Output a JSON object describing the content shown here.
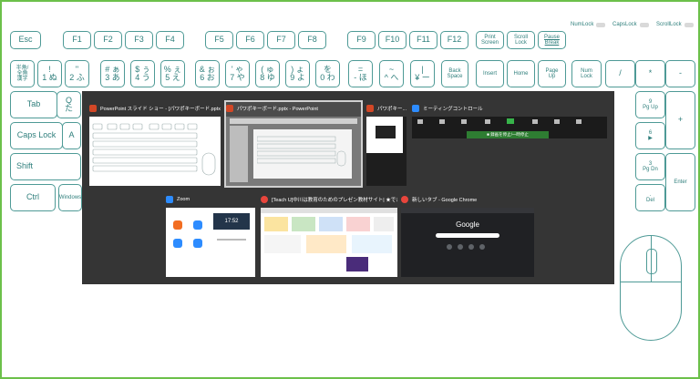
{
  "locks": [
    {
      "label": "NumLock"
    },
    {
      "label": "CapsLock"
    },
    {
      "label": "ScrollLock"
    }
  ],
  "keys": {
    "esc": "Esc",
    "f1": "F1",
    "f2": "F2",
    "f3": "F3",
    "f4": "F4",
    "f5": "F5",
    "f6": "F6",
    "f7": "F7",
    "f8": "F8",
    "f9": "F9",
    "f10": "F10",
    "f11": "F11",
    "f12": "F12",
    "print_screen": "Print\nScreen",
    "scroll_lock": "Scroll\nLock",
    "pause_break": "Pause\nBreak",
    "hankaku": "半角/\n全角\n漢字",
    "k1": "!\n1 ぬ",
    "k2": "\"\n2 ふ",
    "k3": "# ぁ\n3 あ",
    "k4": "$ ぅ\n4 う",
    "k5": "% ぇ\n5 え",
    "k6": "& ぉ\n6 お",
    "k7": "' ゃ\n7 や",
    "k8": "( ゅ\n8 ゆ",
    "k9": ") ょ\n9 よ",
    "k0": "を\n0 わ",
    "minus": "=\n- ほ",
    "caret": "~\n^ へ",
    "yen": "|\n¥ ー",
    "backspace": "Back\nSpace",
    "insert": "Insert",
    "home": "Home",
    "page_up": "Page\nUp",
    "numlock": "Num\nLock",
    "slash": "/",
    "asterisk": "*",
    "num_minus": "-",
    "num9": "9\nPg Up",
    "plus": "+",
    "num6": "6\n▶",
    "num3": "3\nPg Dn",
    "enter": "Enter",
    "num_dot": ".\nDel",
    "tab": "Tab",
    "caps_lock": "Caps Lock",
    "shift": "Shift",
    "ctrl": "Ctrl",
    "windows": "Windows",
    "q": "Q\nた",
    "a": "A"
  },
  "switcher": {
    "windows": [
      {
        "title": "PowerPoint スライド ショー - [パワポキーボード.pptx]",
        "app": "powerpoint"
      },
      {
        "title": "パワポキーボード.pptx - PowerPoint",
        "app": "powerpoint",
        "selected": true
      },
      {
        "title": "パワポキー...",
        "app": "powerpoint"
      },
      {
        "title": "ミーティングコントロール",
        "app": "zoom"
      },
      {
        "title": "Zoom",
        "app": "zoom"
      },
      {
        "title": "[Teach U]中川は教育のためのプレゼン教材サイト| ★できる...",
        "app": "chrome"
      },
      {
        "title": "新しいタブ - Google Chrome",
        "app": "chrome"
      }
    ],
    "zoom_time": "17:52",
    "google_logo": "Google",
    "meeting_button": "■ 録画を停止/一時停止"
  },
  "colors": {
    "key_border": "#4e9a96",
    "key_text": "#2f7f7c",
    "frame": "#6cc04a",
    "overlay": "#262626"
  }
}
